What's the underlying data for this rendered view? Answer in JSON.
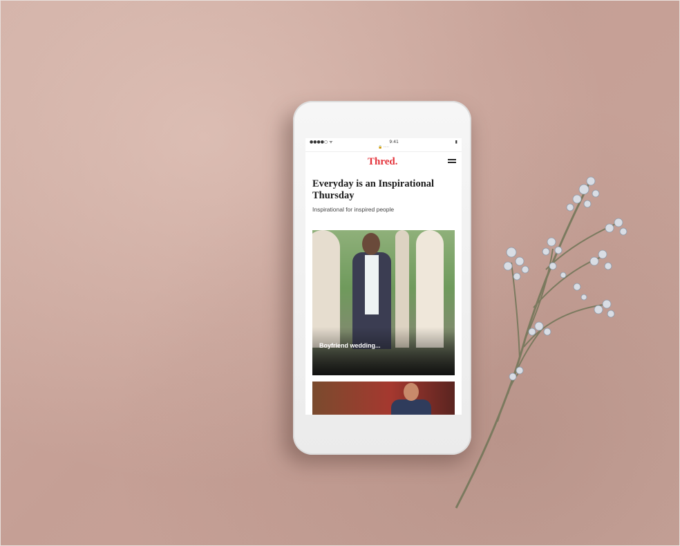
{
  "phone": {
    "status_bar": {
      "left": "●●●●○ ᯤ",
      "time": "9:41",
      "right": "▮"
    },
    "url_bar": "🔒 ·····",
    "app": {
      "logo": "Thred.",
      "headline": "Everyday is an Inspirational Thursday",
      "subhead": "Inspirational for inspired people",
      "feature_card": {
        "title": "Boyfriend wedding...",
        "meta": ""
      }
    }
  },
  "colors": {
    "background": "#c9a79d",
    "phone_body": "#f2f2f2",
    "logo_red": "#e4343c"
  }
}
